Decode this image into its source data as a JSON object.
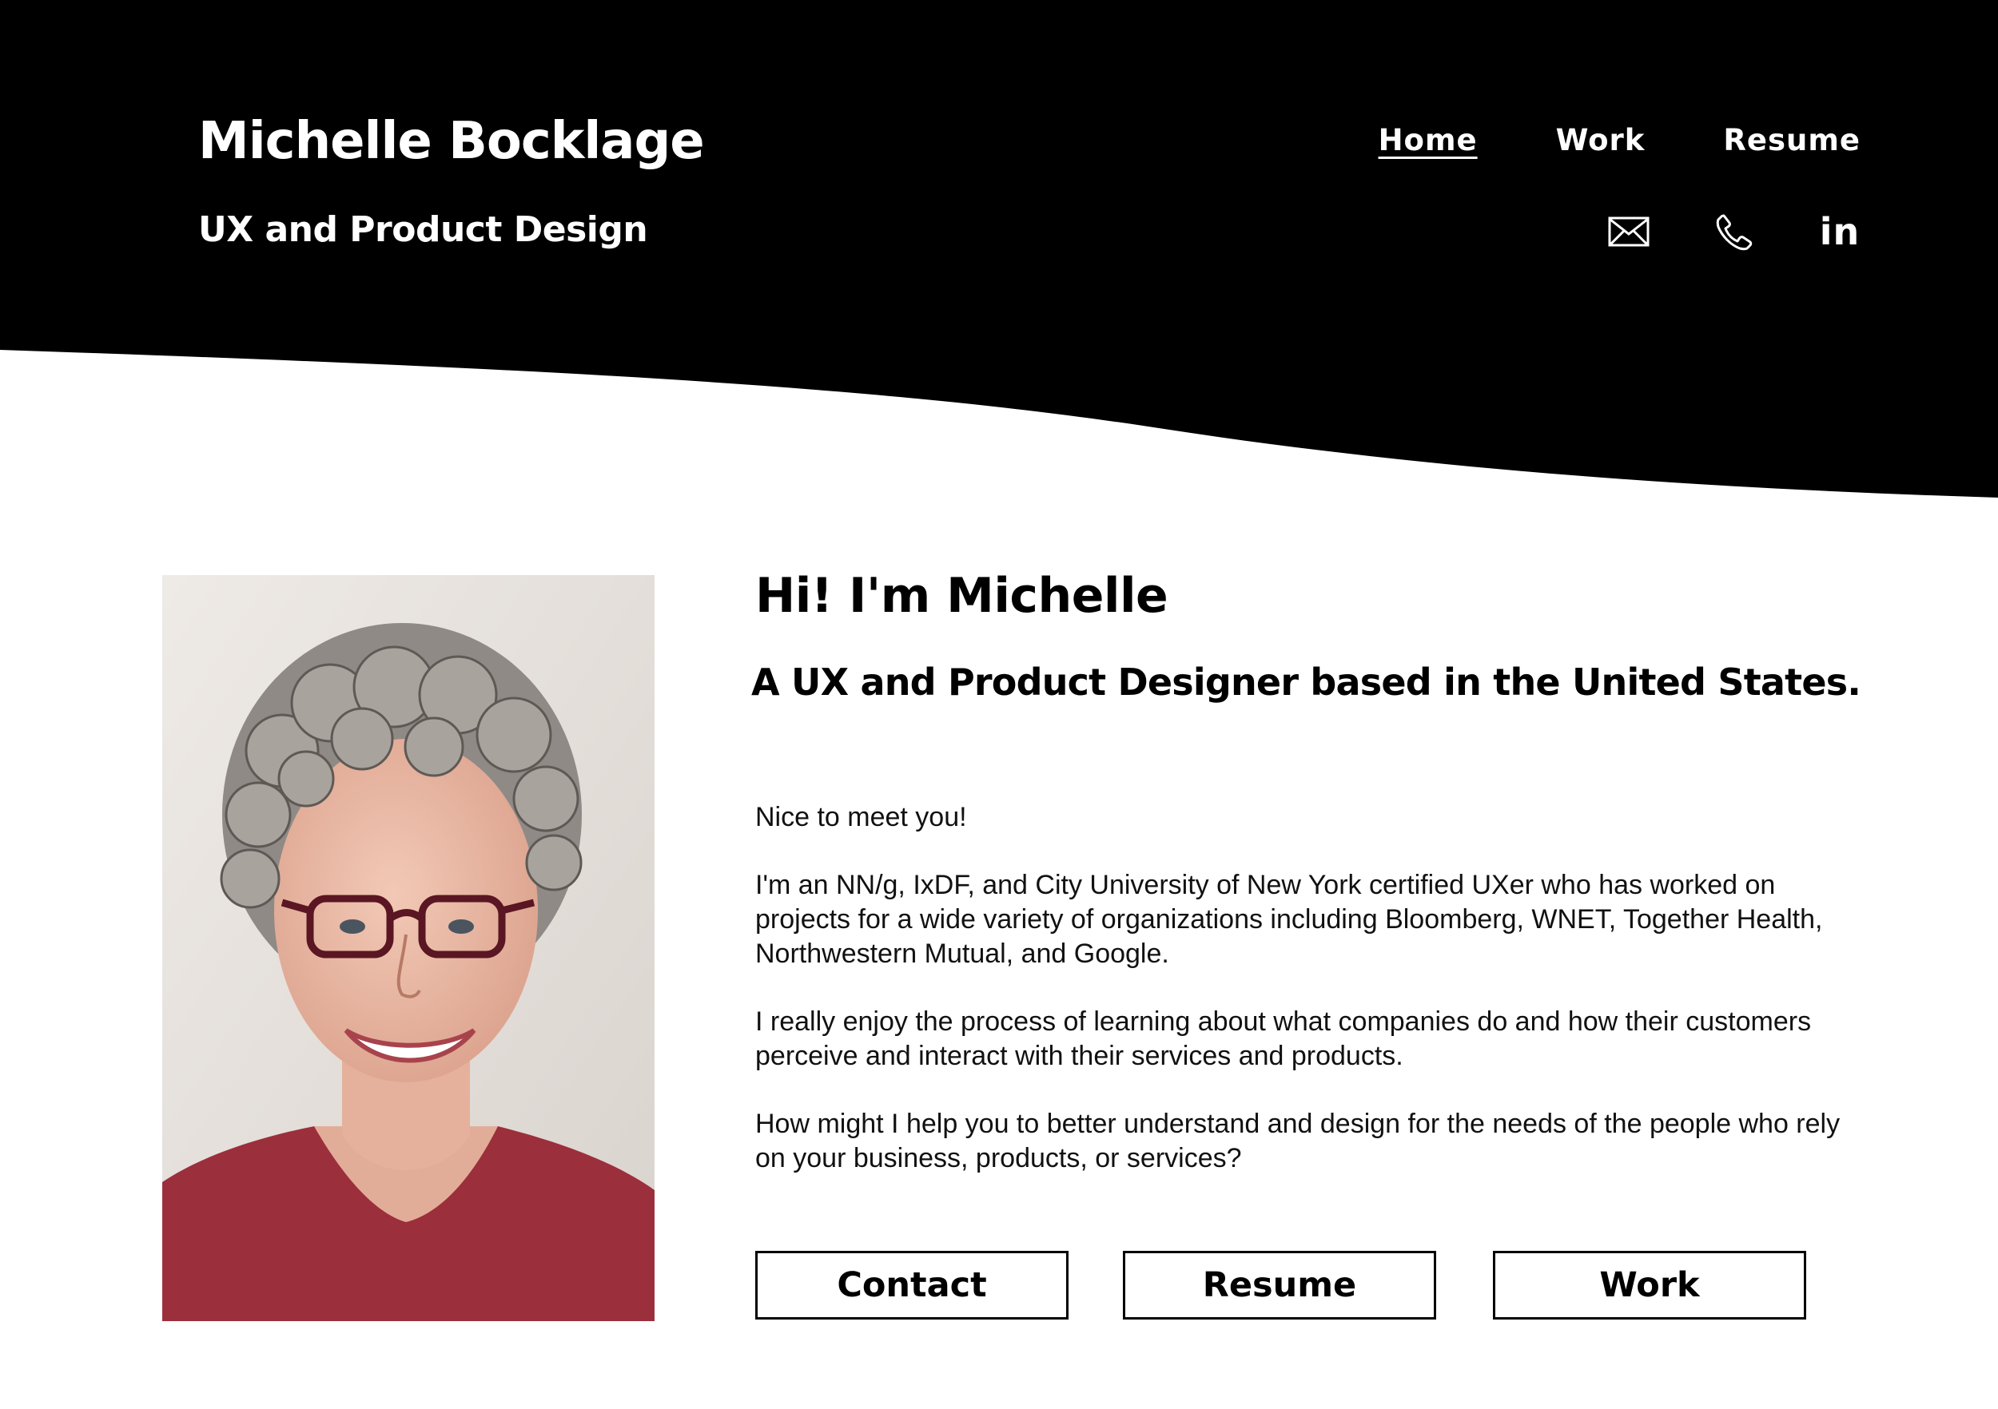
{
  "header": {
    "site_name": "Michelle Bocklage",
    "tagline": "UX and Product Design",
    "background_color": "#000000",
    "nav": [
      {
        "label": "Home",
        "active": true
      },
      {
        "label": "Work",
        "active": false
      },
      {
        "label": "Resume",
        "active": false
      }
    ],
    "social_icons": [
      "email-icon",
      "phone-icon",
      "linkedin-icon"
    ],
    "linkedin_glyph": "in"
  },
  "intro": {
    "greeting": "Hi! I'm Michelle",
    "headline": "A UX and Product Designer based in the United States.",
    "paragraphs": [
      "Nice to meet you!",
      "I'm an NN/g, IxDF, and City University of New York certified UXer who has worked on projects for a wide variety of organizations including Bloomberg, WNET, Together Health, Northwestern Mutual, and Google.",
      "I really enjoy the process of learning about what companies do and how their customers perceive and interact with their services and products.",
      "How might I help you to better understand and design for the needs of the people who rely on your business, products, or services?"
    ]
  },
  "buttons": {
    "contact": "Contact",
    "resume": "Resume",
    "work": "Work"
  },
  "colors": {
    "header": "#000000",
    "page": "#ffffff",
    "text": "#000000"
  }
}
